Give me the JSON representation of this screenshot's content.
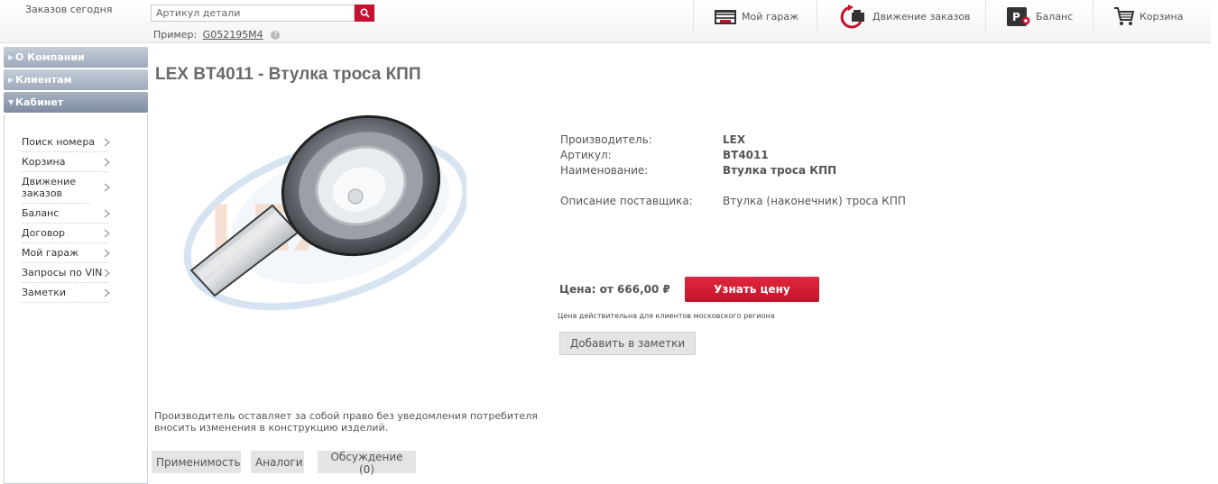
{
  "header": {
    "orders_today": "Заказов сегодня",
    "search_placeholder": "Артикул детали",
    "example_label": "Пример:",
    "example_code": "G052195M4",
    "help": "?",
    "nav": {
      "garage": "Мой гараж",
      "orders": "Движение заказов",
      "balance": "Баланс",
      "cart": "Корзина"
    }
  },
  "sidebar": {
    "sections": [
      "О Компании",
      "Клиентам",
      "Кабинет"
    ],
    "items": [
      {
        "label": "Поиск номера"
      },
      {
        "label": "Корзина"
      },
      {
        "label": "Движение заказов"
      },
      {
        "label": "Баланс"
      },
      {
        "label": "Договор"
      },
      {
        "label": "Мой гараж"
      },
      {
        "label": "Запросы по VIN"
      },
      {
        "label": "Заметки"
      }
    ]
  },
  "product": {
    "title": "LEX BT4011 - Втулка троса КПП",
    "manufacturer_label": "Производитель:",
    "manufacturer": "LEX",
    "article_label": "Артикул:",
    "article": "BT4011",
    "name_label": "Наименование:",
    "name": "Втулка троса КПП",
    "supplier_desc_label": "Описание поставщика:",
    "supplier_desc": "Втулка (наконечник) троса КПП",
    "price": "Цена: от 666,00 ₽",
    "price_button": "Узнать цену",
    "price_note": "Цена действительна для клиентов московского региона",
    "notes_button": "Добавить в заметки",
    "disclaimer": "Производитель оставляет за собой право без уведомления потребителя вносить изменения в конструкцию изделий."
  },
  "tabs": [
    "Применимость",
    "Аналоги",
    "Обсуждение (0)"
  ],
  "colors": {
    "accent_red": "#c8102e",
    "sidebar_head": "#9eaabb",
    "title_gray": "#6a6a6a"
  }
}
